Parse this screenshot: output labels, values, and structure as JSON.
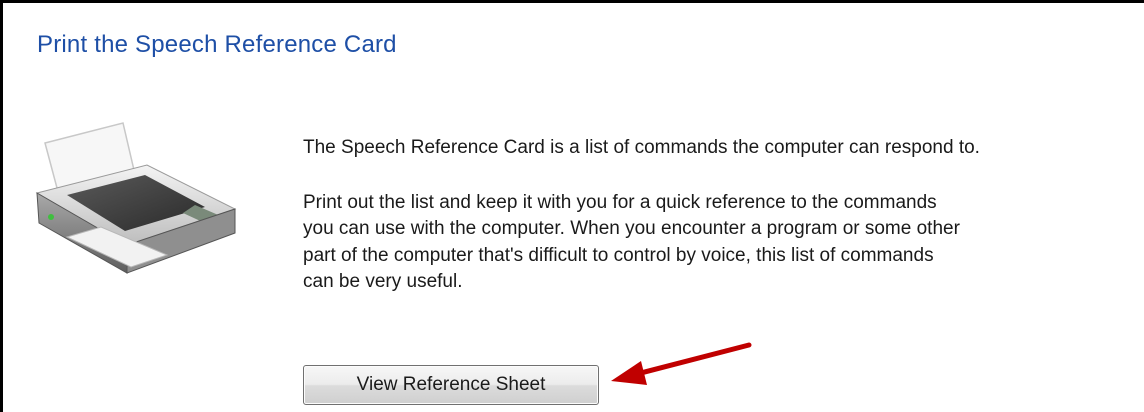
{
  "page": {
    "title": "Print the Speech Reference Card",
    "intro": "The Speech Reference Card is a list of commands the computer can respond to.",
    "description_lines": [
      "Print out the list and keep it with you for a quick reference to the commands",
      "you can use with the computer. When you encounter a program or some other",
      "part of the computer that's difficult to control by voice, this list of commands",
      "can be very useful."
    ],
    "button_label": "View Reference Sheet"
  },
  "icons": {
    "printer": "printer-icon",
    "annotation": "red-arrow-icon"
  },
  "colors": {
    "title": "#1e4fa6",
    "arrow": "#c00000"
  }
}
